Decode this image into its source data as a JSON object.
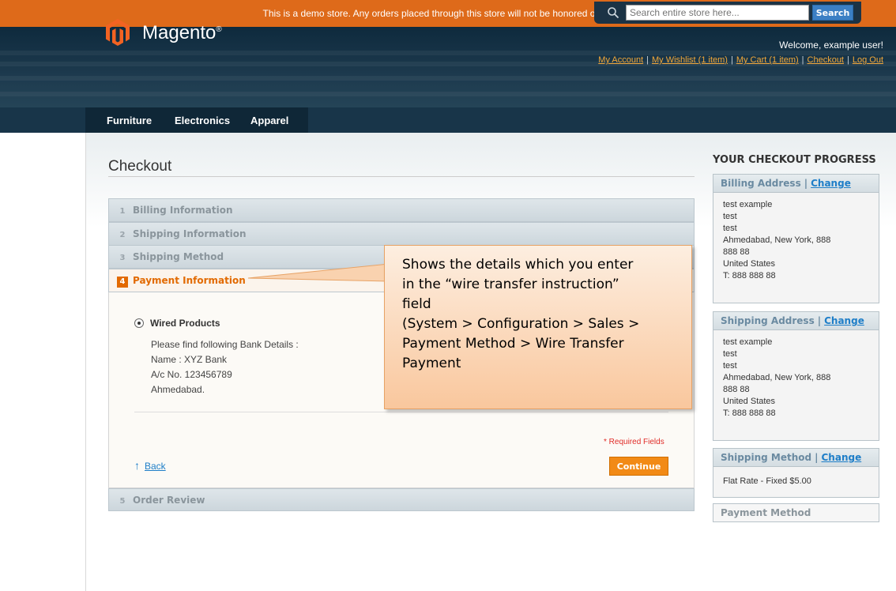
{
  "demo_notice": "This is a demo store. Any orders placed through this store will not be honored or fulfilled.",
  "header": {
    "logo_text": "Magento",
    "logo_reg": "®",
    "search": {
      "placeholder": "Search entire store here...",
      "button_label": "Search"
    },
    "welcome": "Welcome, example user!",
    "links": [
      "My Account",
      "My Wishlist (1 item)",
      "My Cart (1 item)",
      "Checkout",
      "Log Out"
    ],
    "separator": "|"
  },
  "nav": {
    "items": [
      "Furniture",
      "Electronics",
      "Apparel"
    ]
  },
  "page": {
    "title": "Checkout"
  },
  "steps": [
    {
      "num": "1",
      "label": "Billing Information"
    },
    {
      "num": "2",
      "label": "Shipping Information"
    },
    {
      "num": "3",
      "label": "Shipping Method"
    },
    {
      "num": "4",
      "label": "Payment Information"
    },
    {
      "num": "5",
      "label": "Order Review"
    }
  ],
  "payment": {
    "method_label": "Wired Products",
    "bank_details": [
      "Please find following Bank Details :",
      "Name : XYZ Bank",
      "A/c No. 123456789",
      "Ahmedabad."
    ],
    "required_note": "* Required Fields",
    "back_label": "Back",
    "back_arrow": "↑",
    "continue_label": "Continue"
  },
  "callout": {
    "lines": [
      "Shows the details which you enter",
      "in the “wire transfer instruction”",
      "field",
      "(System > Configuration > Sales >",
      "Payment Method > Wire Transfer",
      "Payment"
    ]
  },
  "sidebar": {
    "title": "YOUR CHECKOUT PROGRESS",
    "change_label": "Change",
    "separator": "|",
    "billing": {
      "heading": "Billing Address",
      "lines": [
        "test example",
        "test",
        "test",
        "Ahmedabad, New York, 888",
        "888 88",
        "United States",
        "T: 888 888 88"
      ]
    },
    "shipping": {
      "heading": "Shipping Address",
      "lines": [
        "test example",
        "test",
        "test",
        "Ahmedabad, New York, 888",
        "888 88",
        "United States",
        "T: 888 888 88"
      ]
    },
    "shipping_method": {
      "heading": "Shipping Method",
      "value": "Flat Rate - Fixed $5.00"
    },
    "payment_method": {
      "heading": "Payment Method"
    }
  },
  "colors": {
    "accent": "#e26a00",
    "demo_bar": "#de6a1a",
    "link": "#1e7ec8",
    "header": "#1d3a4e"
  }
}
